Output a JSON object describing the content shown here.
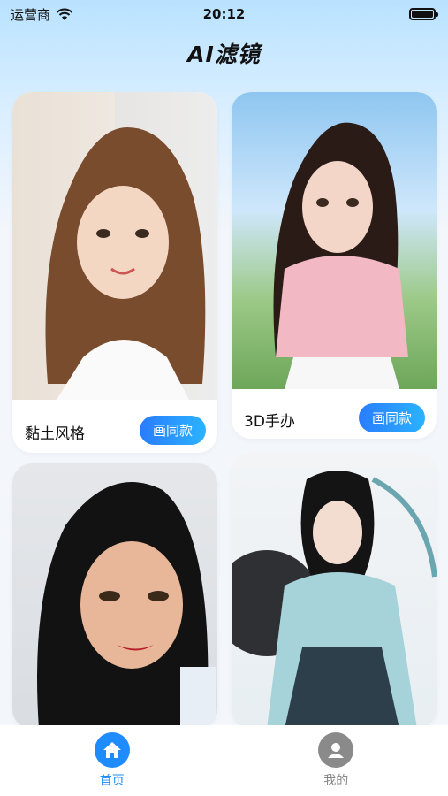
{
  "status": {
    "carrier": "运营商",
    "time": "20:12"
  },
  "header": {
    "title": "AI滤镜"
  },
  "cards": [
    {
      "label": "黏土风格",
      "button": "画同款"
    },
    {
      "label": "3D手办",
      "button": "画同款"
    },
    {
      "label": "",
      "button": ""
    },
    {
      "label": "",
      "button": ""
    }
  ],
  "tabs": [
    {
      "label": "首页",
      "icon": "home-icon",
      "active": true
    },
    {
      "label": "我的",
      "icon": "user-icon",
      "active": false
    }
  ],
  "colors": {
    "accent": "#1e8bff",
    "inactive": "#888888"
  }
}
